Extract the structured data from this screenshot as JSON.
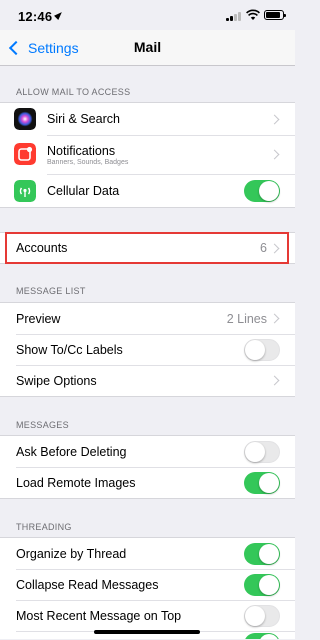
{
  "status_bar": {
    "time": "12:46"
  },
  "nav": {
    "back_label": "Settings",
    "title": "Mail"
  },
  "sections": {
    "allow_access": {
      "header": "ALLOW MAIL TO ACCESS",
      "siri": {
        "label": "Siri & Search"
      },
      "notifications": {
        "label": "Notifications",
        "sublabel": "Banners, Sounds, Badges"
      },
      "cellular": {
        "label": "Cellular Data",
        "toggle": "on"
      }
    },
    "accounts": {
      "label": "Accounts",
      "value": "6"
    },
    "message_list": {
      "header": "MESSAGE LIST",
      "preview": {
        "label": "Preview",
        "value": "2 Lines"
      },
      "show_tocc": {
        "label": "Show To/Cc Labels",
        "toggle": "off"
      },
      "swipe": {
        "label": "Swipe Options"
      }
    },
    "messages": {
      "header": "MESSAGES",
      "ask_delete": {
        "label": "Ask Before Deleting",
        "toggle": "off"
      },
      "load_images": {
        "label": "Load Remote Images",
        "toggle": "on"
      }
    },
    "threading": {
      "header": "THREADING",
      "organize": {
        "label": "Organize by Thread",
        "toggle": "on"
      },
      "collapse": {
        "label": "Collapse Read Messages",
        "toggle": "on"
      },
      "recent_top": {
        "label": "Most Recent Message on Top",
        "toggle": "off"
      }
    }
  },
  "colors": {
    "accent": "#007aff",
    "toggle_on": "#34c759",
    "highlight": "#e53935",
    "siri": "#2c2c6e",
    "notifications": "#ff3b30",
    "cellular": "#34c759"
  }
}
